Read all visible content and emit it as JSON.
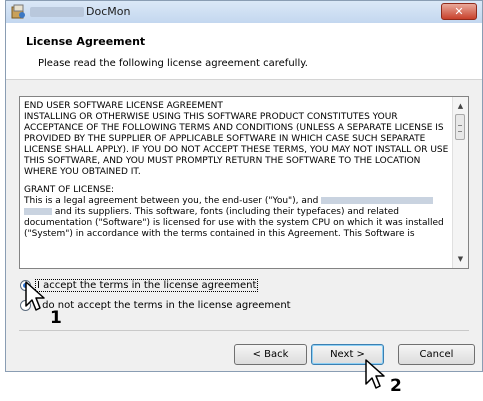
{
  "window": {
    "title": "DocMon",
    "close_label": "✕"
  },
  "header": {
    "title": "License Agreement",
    "subtitle": "Please read the following license agreement carefully."
  },
  "license": {
    "paragraph1": "END USER SOFTWARE LICENSE AGREEMENT\nINSTALLING OR OTHERWISE USING THIS SOFTWARE PRODUCT CONSTITUTES YOUR ACCEPTANCE OF THE FOLLOWING TERMS AND CONDITIONS (UNLESS A SEPARATE LICENSE IS PROVIDED BY THE SUPPLIER OF APPLICABLE SOFTWARE IN WHICH CASE SUCH SEPARATE LICENSE SHALL APPLY). IF YOU DO NOT ACCEPT THESE TERMS, YOU MAY NOT INSTALL OR USE THIS SOFTWARE, AND YOU MUST PROMPTLY RETURN THE SOFTWARE TO THE LOCATION WHERE YOU OBTAINED IT.",
    "grant_heading": "GRANT OF LICENSE:",
    "grant_line1": "This is a legal agreement between you, the end-user (\"You\"), and",
    "grant_line2": "and its suppliers. This software, fonts (including their typefaces) and related documentation (\"Software\") is licensed for use with the system CPU on which it was installed (\"System\") in accordance with the terms contained in this Agreement. This Software is"
  },
  "options": {
    "accept": "I accept the terms in the license agreement",
    "decline": "I do not accept the terms in the license agreement"
  },
  "buttons": {
    "back": "< Back",
    "next": "Next >",
    "cancel": "Cancel"
  },
  "callouts": {
    "step1": "1",
    "step2": "2"
  }
}
